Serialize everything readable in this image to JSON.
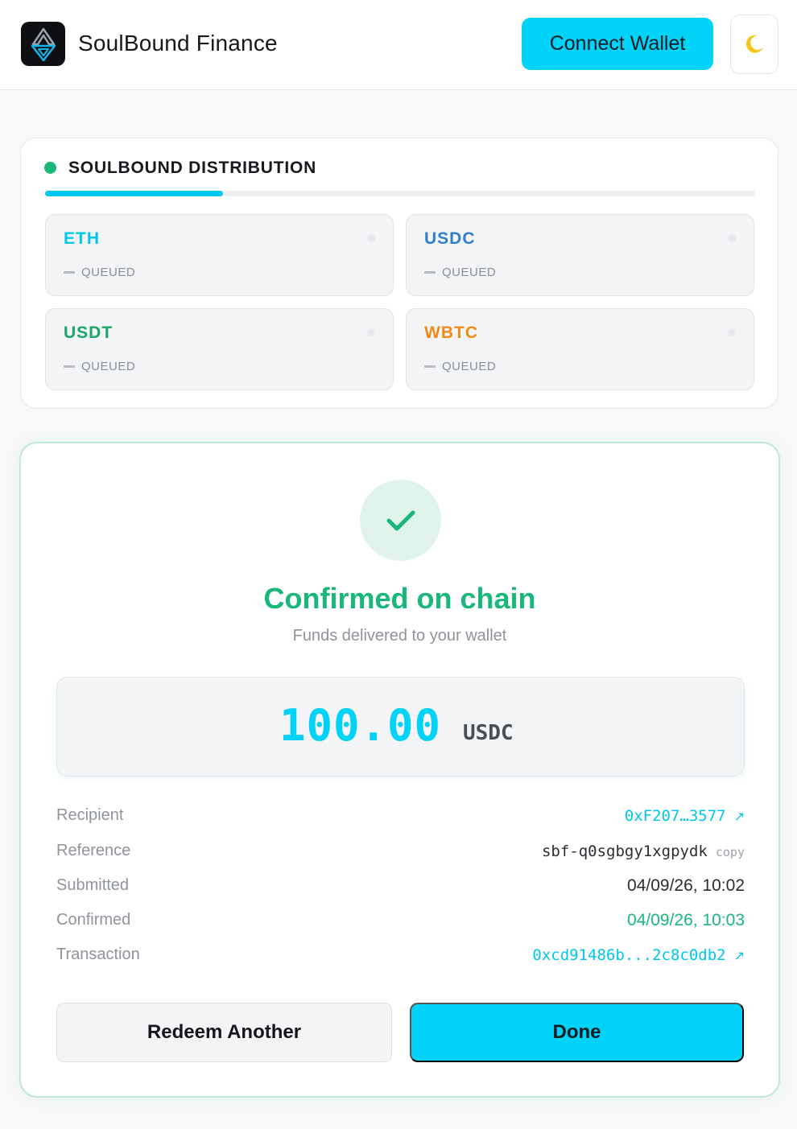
{
  "header": {
    "brand": "SoulBound Finance",
    "connect_label": "Connect Wallet",
    "theme_icon": "moon-icon"
  },
  "distribution": {
    "title": "SOULBOUND DISTRIBUTION",
    "progress_fraction": 0.25,
    "tokens": [
      {
        "name": "ETH",
        "status": "QUEUED",
        "color": "#00c6ea"
      },
      {
        "name": "USDC",
        "status": "QUEUED",
        "color": "#2f7fd1"
      },
      {
        "name": "USDT",
        "status": "QUEUED",
        "color": "#1aa56b"
      },
      {
        "name": "WBTC",
        "status": "QUEUED",
        "color": "#f28a1a"
      }
    ]
  },
  "confirmation": {
    "title": "Confirmed on chain",
    "subtitle": "Funds delivered to your wallet",
    "amount": "100.00",
    "currency": "USDC",
    "details": {
      "recipient_label": "Recipient",
      "recipient_value": "0xF207…3577",
      "reference_label": "Reference",
      "reference_value": "sbf-q0sgbgy1xgpydk",
      "copy_label": "copy",
      "submitted_label": "Submitted",
      "submitted_value": "04/09/26, 10:02",
      "confirmed_label": "Confirmed",
      "confirmed_value": "04/09/26, 10:03",
      "transaction_label": "Transaction",
      "transaction_value": "0xcd91486b...2c8c0db2"
    },
    "redeem_label": "Redeem Another",
    "done_label": "Done"
  },
  "colors": {
    "accent": "#00d3f7",
    "success": "#19b77a"
  }
}
